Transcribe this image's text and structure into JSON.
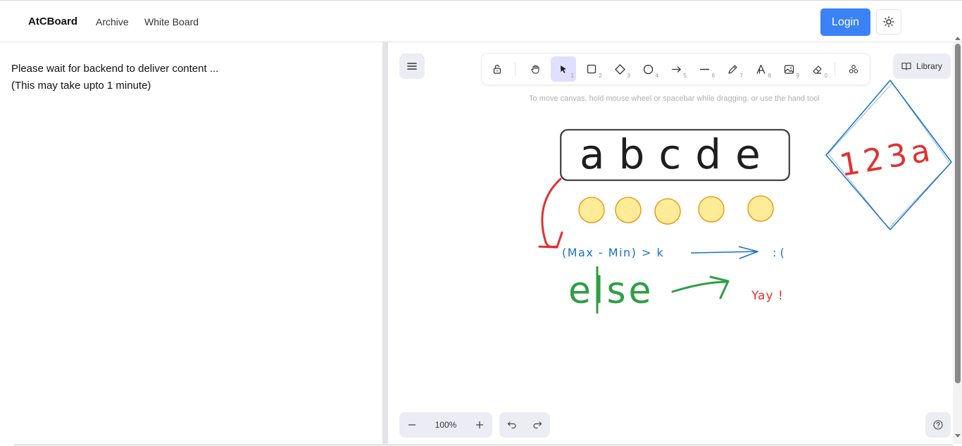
{
  "nav": {
    "brand": "AtCBoard",
    "links": [
      "Archive",
      "White Board"
    ],
    "login_label": "Login",
    "theme_icon": "sun-icon"
  },
  "left": {
    "line1": "Please wait for backend to deliver content ...",
    "line2": "(This may take upto 1 minute)"
  },
  "canvas": {
    "hint": "To move canvas, hold mouse wheel or spacebar while dragging, or use the hand tool",
    "library_label": "Library",
    "zoom": "100%",
    "tools": [
      {
        "name": "lock-icon",
        "key": ""
      },
      {
        "name": "hand-icon",
        "key": ""
      },
      {
        "name": "selection-icon",
        "key": "1",
        "active": true
      },
      {
        "name": "rectangle-icon",
        "key": "2"
      },
      {
        "name": "diamond-icon",
        "key": "3"
      },
      {
        "name": "ellipse-icon",
        "key": "4"
      },
      {
        "name": "arrow-icon",
        "key": "5"
      },
      {
        "name": "line-icon",
        "key": "6"
      },
      {
        "name": "pencil-icon",
        "key": "7"
      },
      {
        "name": "text-icon",
        "key": "8"
      },
      {
        "name": "image-icon",
        "key": "9"
      },
      {
        "name": "eraser-icon",
        "key": "0"
      },
      {
        "name": "shapes-icon",
        "key": ""
      }
    ],
    "drawing": {
      "box_text": "abcde",
      "diamond_text": "123a",
      "formula_text": "(Max - Min) > k",
      "sad_text": ": (",
      "else_text": "else",
      "yay_text": "Yay !",
      "colors": {
        "black": "#1e1e1e",
        "red": "#e03131",
        "blue": "#1971c2",
        "green": "#2f9e44",
        "yellow_fill": "#ffec99",
        "yellow_stroke": "#f08c00"
      }
    }
  }
}
